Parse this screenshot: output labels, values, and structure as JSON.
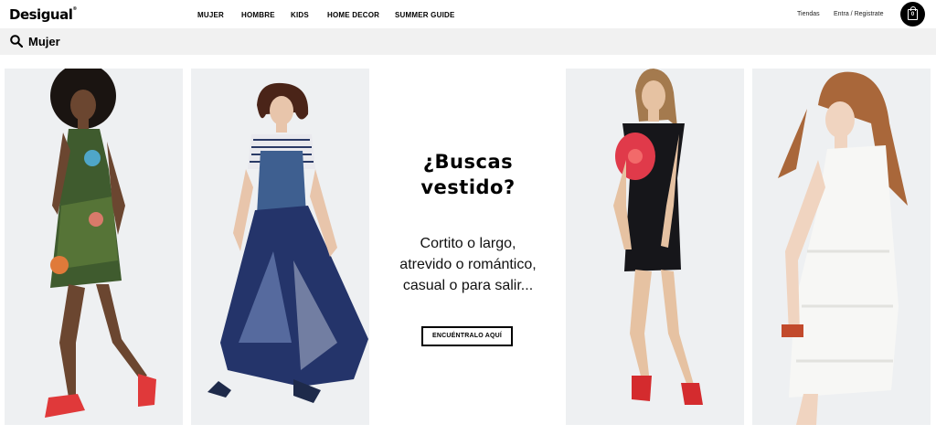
{
  "header": {
    "logo": "Desigual",
    "logo_mark": "®",
    "nav": [
      "MUJER",
      "HOMBRE",
      "KIDS",
      "HOME DECOR",
      "SUMMER GUIDE"
    ],
    "stores_link": "Tiendas",
    "account_link": "Entra / Registrate",
    "cart_count": "0"
  },
  "search": {
    "label": "Mujer"
  },
  "promo": {
    "title": "¿Buscas\nvestido?",
    "body": "Cortito o largo,\natrevido o romántico,\ncasual o para salir...",
    "button": "ENCUÉNTRALO AQUÍ"
  },
  "colors": {
    "background": "#ffffff",
    "search_bar": "#f1f1f1",
    "card_background": "#eef0f2",
    "text": "#000000"
  }
}
